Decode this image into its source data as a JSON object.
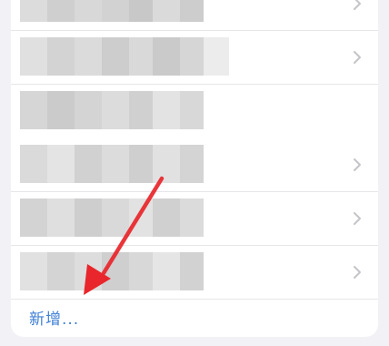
{
  "list": {
    "rows": [
      {
        "label": ""
      },
      {
        "label": ""
      },
      {
        "label": ""
      },
      {
        "label": ""
      },
      {
        "label": ""
      },
      {
        "label": ""
      }
    ],
    "chevron_icon": "chevron-right-icon"
  },
  "add_link": {
    "label": "新增..."
  },
  "annotation": {
    "icon": "red-arrow-icon",
    "color": "#e8262b"
  },
  "colors": {
    "accent": "#3f7fd6",
    "background": "#f2f2f6",
    "card": "#ffffff",
    "chevron": "#c4c4c9",
    "arrow": "#e8262b"
  }
}
